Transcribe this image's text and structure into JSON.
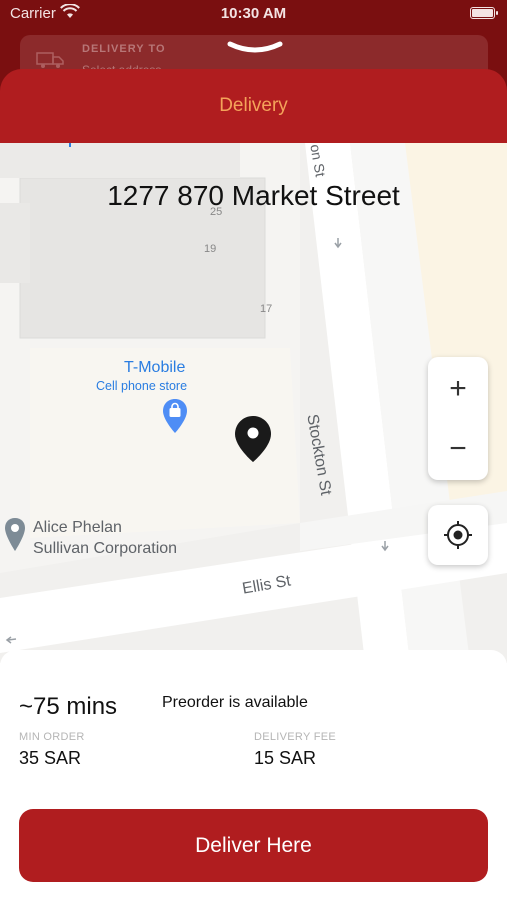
{
  "status_bar": {
    "carrier": "Carrier",
    "time": "10:30 AM"
  },
  "background_card": {
    "label": "DELIVERY TO",
    "value": "Select address"
  },
  "sheet": {
    "title": "Delivery"
  },
  "map": {
    "address": "1277 870 Market Street",
    "building_numbers": [
      "25",
      "19",
      "17"
    ],
    "poi": {
      "name": "T-Mobile",
      "category": "Cell phone store"
    },
    "poi2": {
      "line1": "Alice Phelan",
      "line2": "Sullivan Corporation"
    },
    "streets": {
      "stockton": "Stockton St",
      "stockton_top": "on St",
      "ellis": "Ellis St"
    },
    "zoom_in": "+",
    "zoom_out": "−"
  },
  "info": {
    "eta": "~75 mins",
    "preorder": "Preorder is available",
    "min_order_label": "MIN ORDER",
    "min_order_value": "35 SAR",
    "delivery_fee_label": "DELIVERY FEE",
    "delivery_fee_value": "15 SAR"
  },
  "action": {
    "deliver_label": "Deliver Here"
  },
  "colors": {
    "brand": "#b01d1f",
    "title_accent": "#f4a35a",
    "poi_blue": "#2a7de1"
  }
}
